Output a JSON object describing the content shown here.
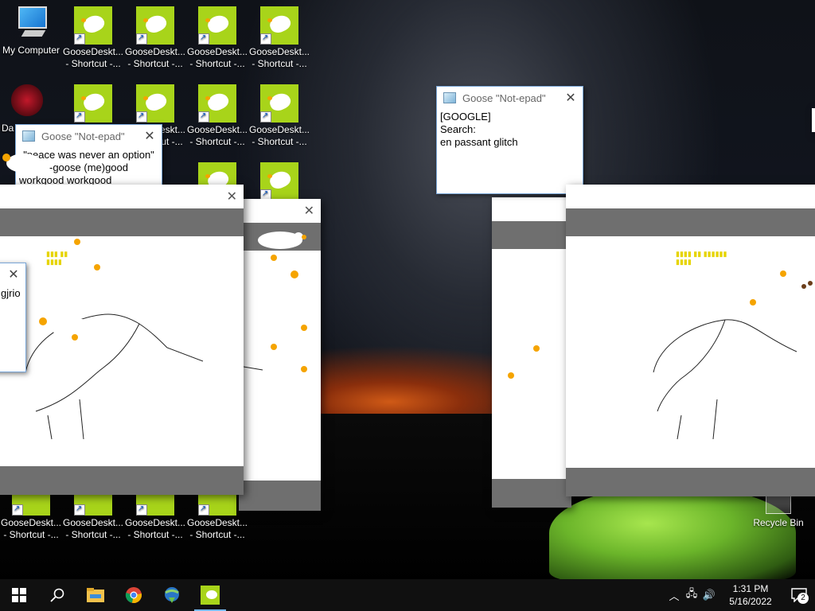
{
  "desktop": {
    "my_computer_label": "My Computer",
    "shortcut_label_line1": "GooseDeskt...",
    "shortcut_label_line2": "- Shortcut -...",
    "partial_icon_label": "Da",
    "recycle_bin_label": "Recycle Bin"
  },
  "notepads": [
    {
      "title": "Goose \"Not-epad\"",
      "lines": [
        "\"peace was never an option\"",
        "-goose (me)good",
        "workgood workgood"
      ]
    },
    {
      "title": "Goose \"Not-epad\"",
      "lines": [
        "[GOOGLE]",
        "Search:",
        "en passant glitch"
      ]
    }
  ],
  "partial_dialog": {
    "text": "gjrio"
  },
  "taskbar": {
    "clock_time": "1:31 PM",
    "clock_date": "5/16/2022",
    "notification_count": "2"
  },
  "colors": {
    "accent": "#76b9ed",
    "shortcut_bg": "#a8d41a",
    "goose_beak": "#f5a400"
  }
}
